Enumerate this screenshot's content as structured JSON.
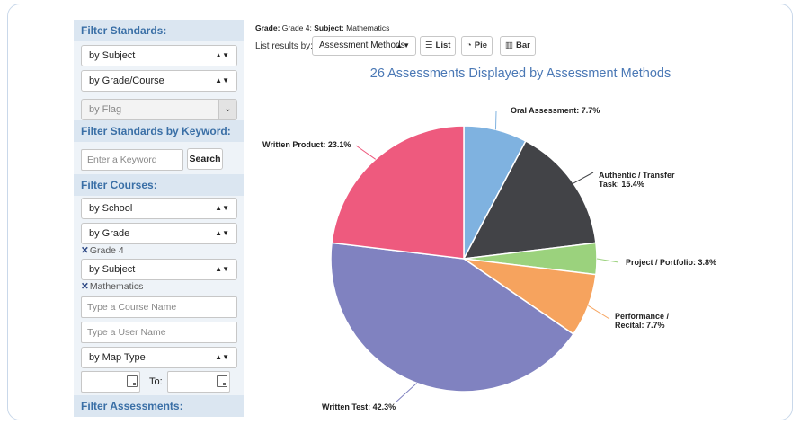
{
  "sidebar": {
    "filter_standards": {
      "heading": "Filter Standards:",
      "subject": "by Subject",
      "grade_course": "by Grade/Course",
      "flag": "by Flag"
    },
    "keyword": {
      "heading": "Filter Standards by Keyword:",
      "placeholder": "Enter a Keyword",
      "search_button": "Search"
    },
    "courses": {
      "heading": "Filter Courses:",
      "school": "by School",
      "grade": "by Grade",
      "grade_tag": "Grade 4",
      "subject": "by Subject",
      "subject_tag": "Mathematics",
      "course_name_placeholder": "Type a Course Name",
      "user_name_placeholder": "Type a User Name",
      "map_type": "by Map Type",
      "to_label": "To:"
    },
    "assessments_heading": "Filter Assessments:",
    "remove_mark": "✕",
    "updown_glyph": "▲▼",
    "chevron_glyph": "⌄"
  },
  "breadcrumb": {
    "grade_label": "Grade:",
    "grade_value": "Grade 4;",
    "subject_label": "Subject:",
    "subject_value": "Mathematics"
  },
  "toolbar": {
    "list_results_label": "List results by:",
    "method_select": "Assessment Methods",
    "list_button": "List",
    "pie_button": "Pie",
    "bar_button": "Bar",
    "list_icon_glyph": "☰",
    "pie_icon_glyph": "◔",
    "bar_icon_glyph": "▥"
  },
  "chart_data": {
    "type": "pie",
    "title": "26 Assessments Displayed by Assessment Methods",
    "slices": [
      {
        "label": "Oral Assessment",
        "value": 7.7,
        "label_text": "Oral Assessment: 7.7%",
        "color": "#7fb2e0"
      },
      {
        "label": "Authentic / Transfer Task",
        "value": 15.4,
        "label_lines": [
          "Authentic / Transfer",
          "Task: 15.4%"
        ],
        "color": "#424347"
      },
      {
        "label": "Project / Portfolio",
        "value": 3.8,
        "label_text": "Project / Portfolio: 3.8%",
        "color": "#9bd27d"
      },
      {
        "label": "Performance / Recital",
        "value": 7.7,
        "label_lines": [
          "Performance /",
          "Recital: 7.7%"
        ],
        "color": "#f6a35e"
      },
      {
        "label": "Written Test",
        "value": 42.3,
        "label_text": "Written Test: 42.3%",
        "color": "#8082c0"
      },
      {
        "label": "Written Product",
        "value": 23.1,
        "label_text": "Written Product: 23.1%",
        "color": "#ee5a7e"
      }
    ]
  }
}
